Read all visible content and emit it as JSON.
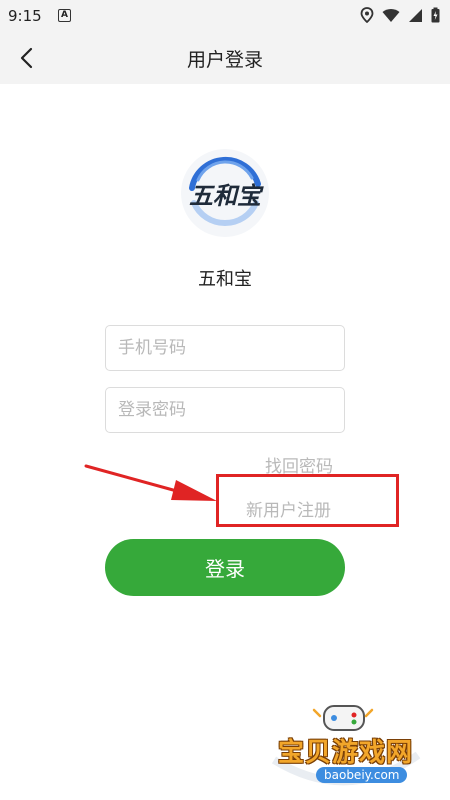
{
  "status_bar": {
    "time": "9:15",
    "notif_letter": "A"
  },
  "header": {
    "title": "用户登录"
  },
  "logo": {
    "text": "五和宝"
  },
  "app_name": "五和宝",
  "form": {
    "phone_placeholder": "手机号码",
    "password_placeholder": "登录密码",
    "forgot_label": "找回密码",
    "register_label": "新用户注册",
    "login_label": "登录"
  },
  "annotation": {
    "highlight_color": "#e02424"
  },
  "watermark": {
    "title": "宝贝游戏网",
    "domain": "baobeiy.com"
  },
  "colors": {
    "accent": "#36a93a",
    "header_bg": "#f3f3f3"
  }
}
